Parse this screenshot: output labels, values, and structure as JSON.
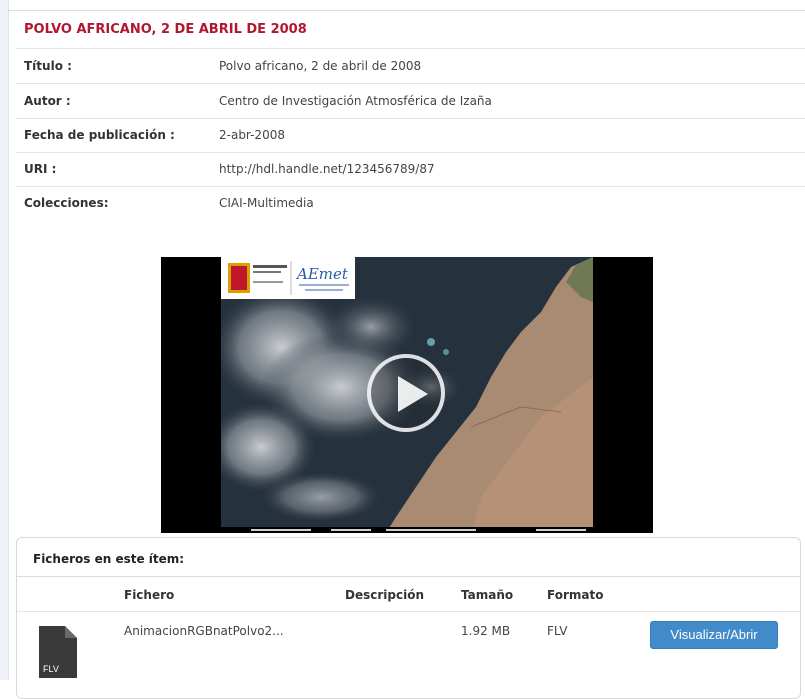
{
  "record": {
    "title": "POLVO AFRICANO, 2 DE ABRIL DE 2008"
  },
  "metadata": [
    {
      "label": "Título :",
      "value": "Polvo africano, 2 de abril de 2008"
    },
    {
      "label": "Autor :",
      "value": "Centro de Investigación Atmosférica de Izaña"
    },
    {
      "label": "Fecha de publicación :",
      "value": "2-abr-2008"
    },
    {
      "label": "URI :",
      "value": "http://hdl.handle.net/123456789/87"
    },
    {
      "label": "Colecciones:",
      "value": "CIAI-Multimedia"
    }
  ],
  "video": {
    "logo_text": "AEmet",
    "play_icon": "play-icon"
  },
  "files": {
    "heading": "Ficheros en este ítem:",
    "columns": [
      "Fichero",
      "Descripción",
      "Tamaño",
      "Formato"
    ],
    "rows": [
      {
        "name": "AnimacionRGBnatPolvo2...",
        "description": "",
        "size": "1.92 MB",
        "format": "FLV",
        "icon_label": "FLV",
        "button": "Visualizar/Abrir"
      }
    ]
  },
  "colors": {
    "title": "#b0182f",
    "button": "#428bca"
  }
}
